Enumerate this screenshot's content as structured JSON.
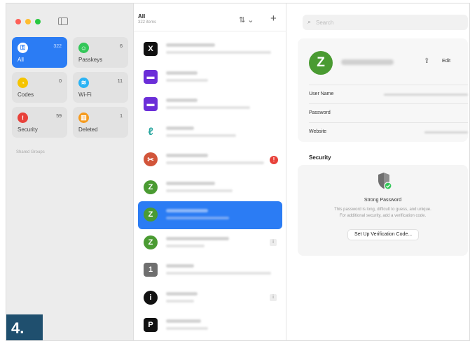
{
  "sidebar": {
    "categories": [
      {
        "label": "All",
        "count": "322",
        "icon": "key-icon",
        "color": "#2b7cf4",
        "glyph": "⚿"
      },
      {
        "label": "Passkeys",
        "count": "6",
        "icon": "person-icon",
        "color": "#34c759",
        "glyph": "☺"
      },
      {
        "label": "Codes",
        "count": "0",
        "icon": "lock-clock-icon",
        "color": "#f5c400",
        "glyph": "◔"
      },
      {
        "label": "Wi-Fi",
        "count": "11",
        "icon": "wifi-icon",
        "color": "#2bb3f4",
        "glyph": "≋"
      },
      {
        "label": "Security",
        "count": "59",
        "icon": "alert-icon",
        "color": "#e8413a",
        "glyph": "!"
      },
      {
        "label": "Deleted",
        "count": "1",
        "icon": "trash-icon",
        "color": "#f59b1f",
        "glyph": "▥"
      }
    ],
    "shared_groups": "Shared Groups"
  },
  "list": {
    "title": "All",
    "count": "322 items",
    "sort_glyph": "⇅ ⌄",
    "add_glyph": "+",
    "items": [
      {
        "icon": "x-logo-icon",
        "bg": "#111111",
        "glyph": "X",
        "shape": "square",
        "badge": ""
      },
      {
        "icon": "yahoo-logo-icon",
        "bg": "#6b2ed8",
        "glyph": "▬",
        "shape": "square",
        "badge": ""
      },
      {
        "icon": "yahoo-logo-icon",
        "bg": "#6b2ed8",
        "glyph": "▬",
        "shape": "square",
        "badge": ""
      },
      {
        "icon": "stethoscope-icon",
        "bg": "#ffffff",
        "glyph": "ℓ",
        "shape": "square",
        "badge": ""
      },
      {
        "icon": "scissors-icon",
        "bg": "#d2553a",
        "glyph": "✂",
        "shape": "circle",
        "badge": "!"
      },
      {
        "icon": "zillow-logo-icon",
        "bg": "#4a9b32",
        "glyph": "Z",
        "shape": "circle",
        "badge": ""
      },
      {
        "icon": "zillow-logo-icon",
        "bg": "#4a9b32",
        "glyph": "Z",
        "shape": "circle",
        "badge": ""
      },
      {
        "icon": "zillow-logo-icon",
        "bg": "#4a9b32",
        "glyph": "Z",
        "shape": "circle",
        "badge": "i"
      },
      {
        "icon": "number-one-icon",
        "bg": "#6f6f6f",
        "glyph": "1",
        "shape": "square",
        "badge": ""
      },
      {
        "icon": "info-circle-icon",
        "bg": "#111111",
        "glyph": "i",
        "shape": "circle",
        "badge": "i"
      },
      {
        "icon": "p-logo-icon",
        "bg": "#111111",
        "glyph": "P",
        "shape": "square",
        "badge": ""
      }
    ]
  },
  "detail": {
    "search_placeholder": "Search",
    "logo_glyph": "Z",
    "edit_label": "Edit",
    "share_glyph": "⇪",
    "fields": [
      {
        "label": "User Name"
      },
      {
        "label": "Password"
      },
      {
        "label": "Website"
      }
    ],
    "security_heading": "Security",
    "strong_title": "Strong Password",
    "strong_desc_1": "This password is long, difficult to guess, and unique.",
    "strong_desc_2": "For additional security, add a verification code.",
    "setup_button": "Set Up Verification Code..."
  },
  "step_label": "4.",
  "colors": {
    "accent": "#2b7cf4",
    "zillow_green": "#4a9b32",
    "alert_red": "#e8413a",
    "step_badge": "#1f4f6e"
  }
}
